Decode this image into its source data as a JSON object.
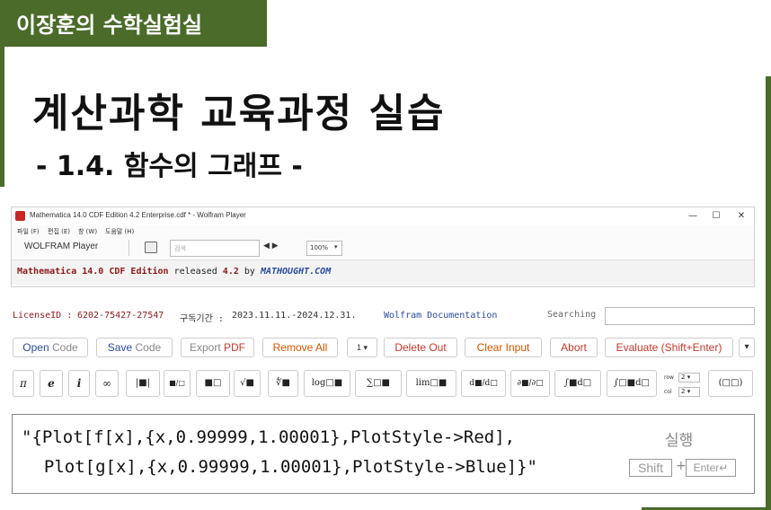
{
  "header": {
    "brand": "이장훈의 수학실험실",
    "title": "계산과학 교육과정 실습",
    "subtitle": "- 1.4. 함수의 그래프 -"
  },
  "window": {
    "title": "Mathematica 14.0 CDF Edition 4.2 Enterprise.cdf * - Wolfram Player",
    "controls": [
      "—",
      "☐",
      "✕"
    ],
    "menu": [
      "파일 (F)",
      "편집 (E)",
      "창 (W)",
      "도움말 (H)"
    ],
    "toolbar": {
      "brand": "WOLFRAM Player",
      "search_placeholder": "검색",
      "nav": "◀ ▶",
      "zoom": "100%"
    },
    "banner": {
      "product": "Mathematica 14.0 CDF Edition",
      "released": " released ",
      "version": "4.2",
      "by": " by ",
      "author": "MATHOUGHT.COM"
    }
  },
  "license": {
    "id_label": "LicenseID : ",
    "id_value": "6202-75427-27547",
    "period_label": "구독기간 : ",
    "period_value": "2023.11.11.-2024.12.31.",
    "docs_link": "Wolfram Documentation",
    "searching_label": "Searching"
  },
  "buttons": {
    "open_code_a": "Open",
    "open_code_b": " Code",
    "save_code_a": "Save",
    "save_code_b": " Code",
    "export_pdf_a": "Export",
    "export_pdf_b": " PDF",
    "remove_all": "Remove All",
    "count": "1",
    "delete_out": "Delete Out",
    "clear_input": "Clear Input",
    "abort": "Abort",
    "evaluate": "Evaluate (Shift+Enter)",
    "more": "▾"
  },
  "palette": {
    "pi": "π",
    "e": "e",
    "i": "i",
    "inf": "∞",
    "abs": "|■|",
    "frac": "■/□",
    "pow": "■□",
    "sqrt": "√■",
    "nroot": "∜■",
    "log": "log□■",
    "sum": "∑□■",
    "lim": "lim□■",
    "deriv": "d■/d□",
    "pderiv": "∂■/∂□",
    "integral": "∫■d□",
    "defint": "∫□■d□",
    "row_label": "row",
    "row_value": "2",
    "col_label": "col",
    "col_value": "2",
    "matrix": "(□□)"
  },
  "code": {
    "line1": "\"{Plot[f[x],{x,0.99999,1.00001},PlotStyle->Red],",
    "line2": "  Plot[g[x],{x,0.99999,1.00001},PlotStyle->Blue]}\"",
    "run_label": "실행",
    "shift_key": "Shift",
    "plus": "+",
    "enter_key": "Enter↵"
  }
}
